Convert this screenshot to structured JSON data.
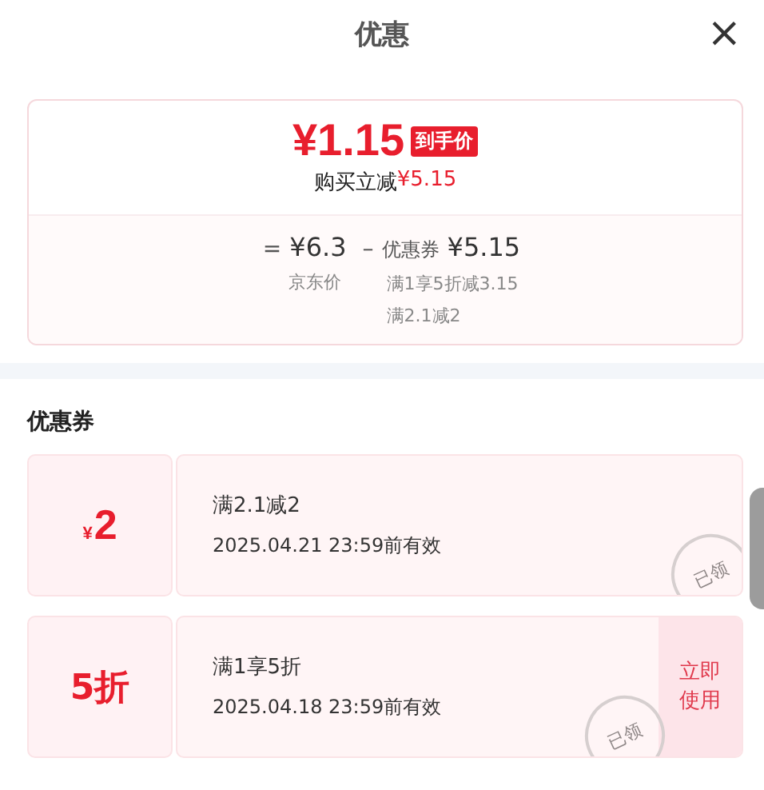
{
  "header": {
    "title": "优惠",
    "close": "×"
  },
  "summary": {
    "price": "¥1.15",
    "badge": "到手价",
    "saving_label": "购买立减",
    "saving_amount": "¥5.15",
    "breakdown": {
      "equals": "=",
      "base_price": "¥6.3",
      "base_label": "京东价",
      "minus": "–",
      "coupon_label": "优惠券",
      "coupon_amount": "¥5.15",
      "details": [
        "满1享5折减3.15",
        "满2.1减2"
      ]
    }
  },
  "coupons_section": {
    "title": "优惠券",
    "coupons": [
      {
        "kind": "cash",
        "currency": "¥",
        "amount": "2",
        "condition": "满2.1减2",
        "validity": "2025.04.21  23:59前有效",
        "stamp": "已领"
      },
      {
        "kind": "discount",
        "amount": "5折",
        "condition": "满1享5折",
        "validity": "2025.04.18  23:59前有效",
        "stamp": "已领",
        "action": "立即使用"
      }
    ]
  }
}
